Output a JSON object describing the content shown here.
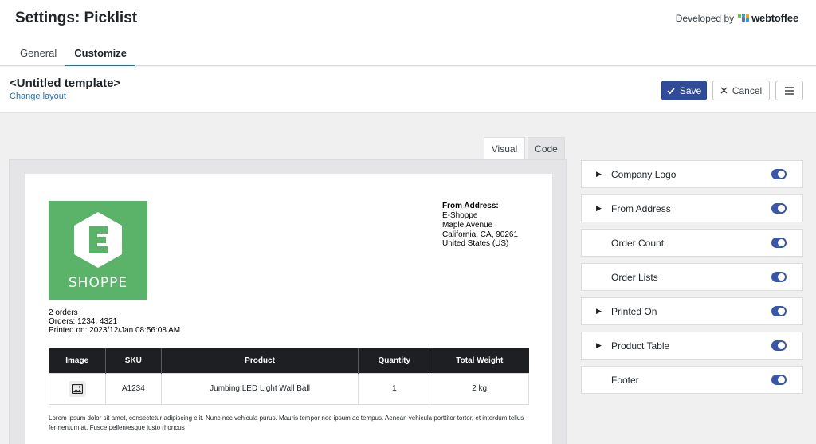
{
  "header": {
    "title": "Settings: Picklist",
    "developed_by": "Developed by",
    "brand": "webtoffee",
    "brand_colors": [
      "#7ac143",
      "#2e9fd9",
      "#f5a623",
      "#5b6cc9",
      "#2e9fd9",
      "#7ac143"
    ]
  },
  "tabs": [
    {
      "label": "General",
      "active": false
    },
    {
      "label": "Customize",
      "active": true
    }
  ],
  "template": {
    "name": "<Untitled template>",
    "change_layout": "Change layout",
    "save_label": "Save",
    "cancel_label": "Cancel",
    "menu_icon": "hamburger-icon"
  },
  "view_tabs": [
    {
      "label": "Visual",
      "active": true
    },
    {
      "label": "Code",
      "active": false
    }
  ],
  "document": {
    "logo": {
      "letter": "E",
      "text": "SHOPPE",
      "color": "#5bb36a"
    },
    "from_address": {
      "title": "From Address:",
      "lines": [
        "E-Shoppe",
        "Maple Avenue",
        "California, CA, 90261",
        "United States (US)"
      ]
    },
    "order_count": "2 orders",
    "orders": "Orders: 1234, 4321",
    "printed_on": "Printed on: 2023/12/Jan 08:56:08 AM",
    "table": {
      "headers": [
        "Image",
        "SKU",
        "Product",
        "Quantity",
        "Total Weight"
      ],
      "rows": [
        {
          "image_icon": "image-icon",
          "sku": "A1234",
          "product": "Jumbing LED Light Wall Ball",
          "quantity": "1",
          "weight": "2 kg"
        }
      ]
    },
    "footer_text": "Lorem ipsum dolor sit amet, consectetur adipiscing elit. Nunc nec vehicula purus. Mauris tempor nec ipsum ac tempus. Aenean vehicula porttitor tortor, et interdum tellus fermentum at. Fusce pellentesque justo rhoncus"
  },
  "sections": [
    {
      "label": "Company Logo",
      "expandable": true,
      "enabled": true
    },
    {
      "label": "From Address",
      "expandable": true,
      "enabled": true
    },
    {
      "label": "Order Count",
      "expandable": false,
      "enabled": true
    },
    {
      "label": "Order Lists",
      "expandable": false,
      "enabled": true
    },
    {
      "label": "Printed On",
      "expandable": true,
      "enabled": true
    },
    {
      "label": "Product Table",
      "expandable": true,
      "enabled": true
    },
    {
      "label": "Footer",
      "expandable": false,
      "enabled": true
    }
  ],
  "colors": {
    "primary": "#2f4b9a",
    "link": "#2271b1",
    "toggle_on": "#3857a8",
    "table_header": "#1d1f22"
  }
}
